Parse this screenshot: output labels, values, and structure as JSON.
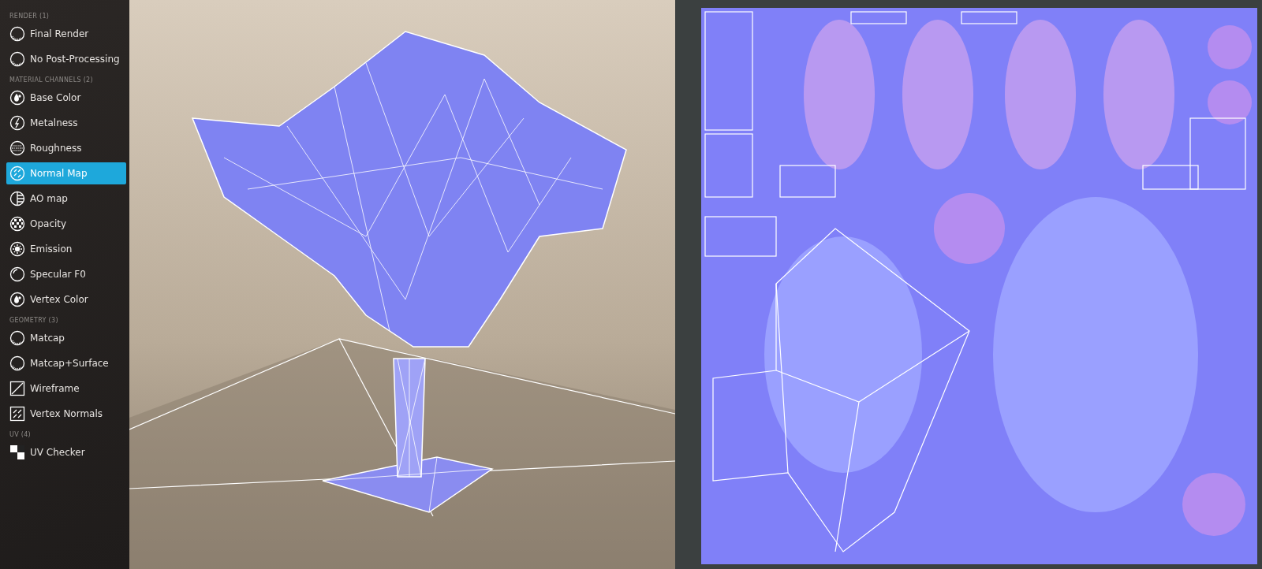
{
  "sidebar": {
    "sections": [
      {
        "title": "RENDER (1)",
        "items": [
          {
            "label": "Final Render",
            "kind": "sphere",
            "selected": false
          },
          {
            "label": "No Post-Processing",
            "kind": "sphere",
            "selected": false
          }
        ]
      },
      {
        "title": "MATERIAL CHANNELS (2)",
        "items": [
          {
            "label": "Base Color",
            "kind": "drop",
            "selected": false
          },
          {
            "label": "Metalness",
            "kind": "bolt",
            "selected": false
          },
          {
            "label": "Roughness",
            "kind": "dots",
            "selected": false
          },
          {
            "label": "Normal Map",
            "kind": "normal",
            "selected": true
          },
          {
            "label": "AO map",
            "kind": "ao",
            "selected": false
          },
          {
            "label": "Opacity",
            "kind": "checker",
            "selected": false
          },
          {
            "label": "Emission",
            "kind": "sun",
            "selected": false
          },
          {
            "label": "Specular F0",
            "kind": "ring",
            "selected": false
          },
          {
            "label": "Vertex Color",
            "kind": "drop",
            "selected": false
          }
        ]
      },
      {
        "title": "GEOMETRY (3)",
        "items": [
          {
            "label": "Matcap",
            "kind": "sphere",
            "selected": false
          },
          {
            "label": "Matcap+Surface",
            "kind": "sphere",
            "selected": false
          },
          {
            "label": "Wireframe",
            "kind": "diagonal",
            "selected": false
          },
          {
            "label": "Vertex Normals",
            "kind": "arrows",
            "selected": false
          }
        ]
      },
      {
        "title": "UV (4)",
        "items": [
          {
            "label": "UV Checker",
            "kind": "uvchecker",
            "selected": false
          }
        ]
      }
    ]
  }
}
